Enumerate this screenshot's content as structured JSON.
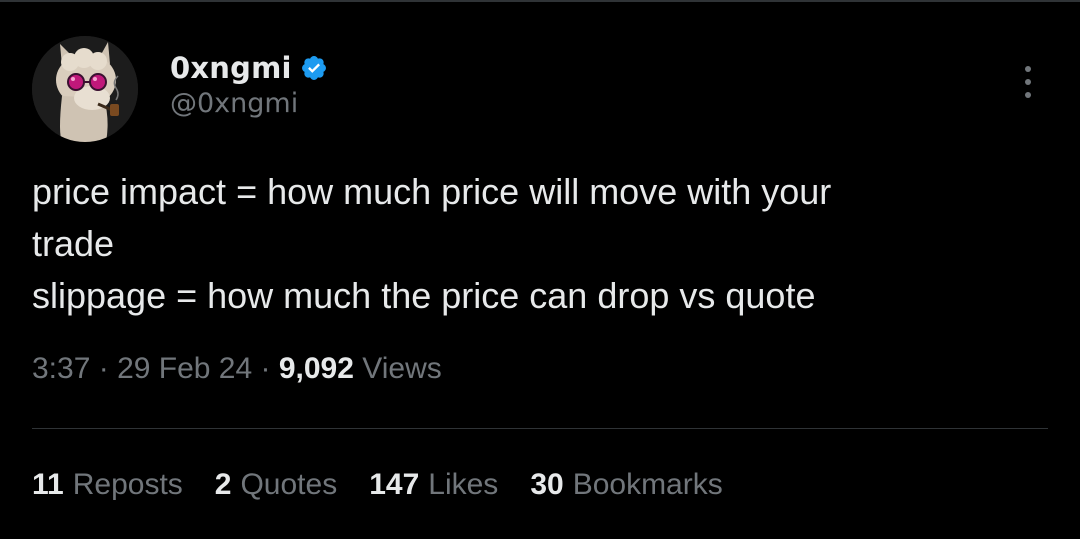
{
  "tweet": {
    "author": {
      "display_name": "0xngmi",
      "handle": "@0xngmi",
      "verified": true,
      "avatar_icon": "llama-avatar-icon"
    },
    "text_lines": [
      "price impact = how much price will move with your",
      "trade",
      "slippage = how much the price can drop vs quote"
    ],
    "meta": {
      "time": "3:37",
      "separator": " · ",
      "date": "29 Feb 24",
      "views_count": "9,092",
      "views_label": "Views"
    },
    "stats": [
      {
        "count": "11",
        "label": "Reposts"
      },
      {
        "count": "2",
        "label": "Quotes"
      },
      {
        "count": "147",
        "label": "Likes"
      },
      {
        "count": "30",
        "label": "Bookmarks"
      }
    ]
  },
  "colors": {
    "background": "#000000",
    "primary_text": "#e7e9ea",
    "secondary_text": "#71767b",
    "divider": "#2f3336",
    "verified_blue": "#1d9bf0"
  }
}
